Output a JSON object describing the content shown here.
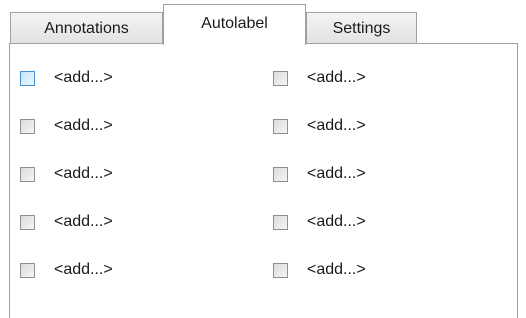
{
  "tabs": [
    {
      "label": "Annotations"
    },
    {
      "label": "Autolabel"
    },
    {
      "label": "Settings"
    }
  ],
  "active_tab": "Autolabel",
  "autolabel": {
    "items": [
      {
        "label": "<add...>",
        "checked": false,
        "focused": true
      },
      {
        "label": "<add...>",
        "checked": false,
        "focused": false
      },
      {
        "label": "<add...>",
        "checked": false,
        "focused": false
      },
      {
        "label": "<add...>",
        "checked": false,
        "focused": false
      },
      {
        "label": "<add...>",
        "checked": false,
        "focused": false
      },
      {
        "label": "<add...>",
        "checked": false,
        "focused": false
      },
      {
        "label": "<add...>",
        "checked": false,
        "focused": false
      },
      {
        "label": "<add...>",
        "checked": false,
        "focused": false
      },
      {
        "label": "<add...>",
        "checked": false,
        "focused": false
      },
      {
        "label": "<add...>",
        "checked": false,
        "focused": false
      }
    ]
  },
  "colors": {
    "border": "#a0a0a0",
    "checkbox_focus": "#4a90d0",
    "text": "#1a1a1a"
  }
}
